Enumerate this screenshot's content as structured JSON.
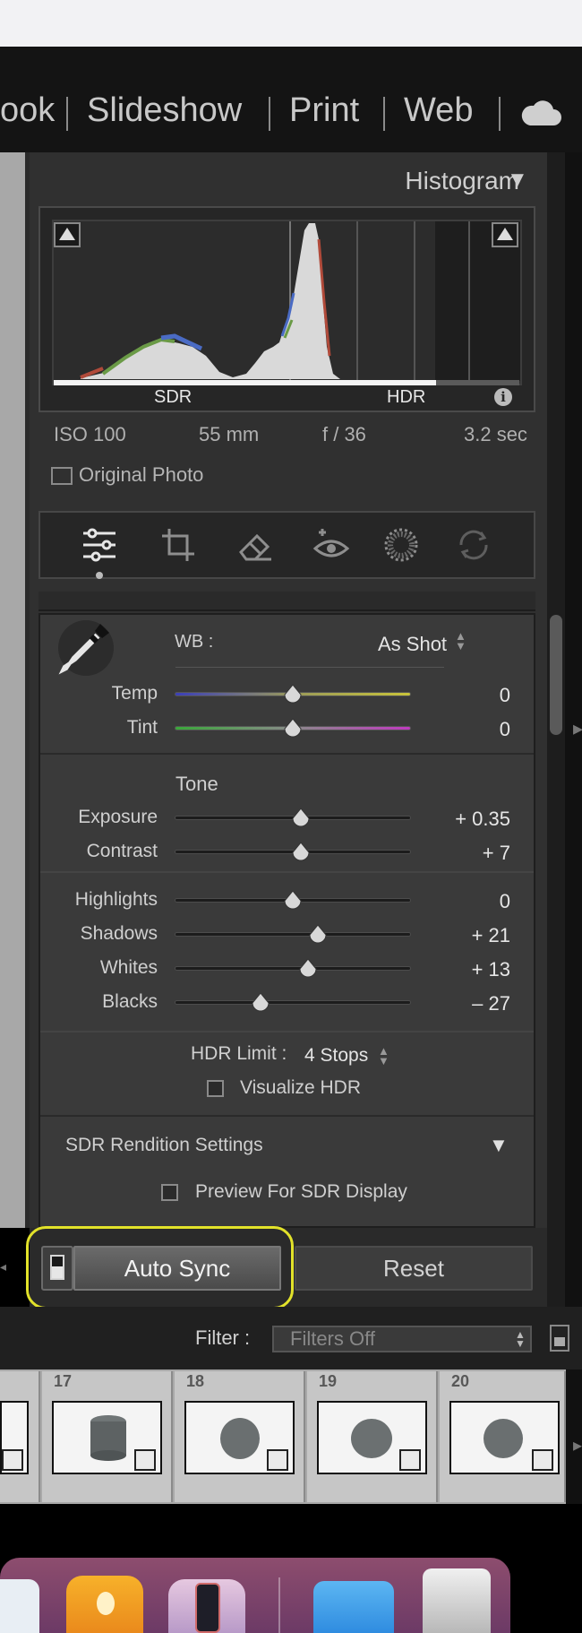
{
  "nav": {
    "modules": [
      "ook",
      "Slideshow",
      "Print",
      "Web"
    ],
    "cloud_icon": "cloud-icon"
  },
  "histogram": {
    "title": "Histogram",
    "sdr_label": "SDR",
    "hdr_label": "HDR",
    "exif": {
      "iso": "ISO 100",
      "focal": "55 mm",
      "aperture": "f / 36",
      "shutter": "3.2 sec"
    },
    "original_photo_label": "Original Photo"
  },
  "tools": [
    "edit-sliders-icon",
    "crop-icon",
    "eraser-icon",
    "redeye-icon",
    "masking-icon",
    "presets-icon"
  ],
  "white_balance": {
    "label": "WB :",
    "value": "As Shot",
    "sliders": [
      {
        "name": "Temp",
        "value": "0",
        "position": 0.5
      },
      {
        "name": "Tint",
        "value": "0",
        "position": 0.5
      }
    ]
  },
  "tone": {
    "label": "Tone",
    "sliders": [
      {
        "name": "Exposure",
        "value": "+ 0.35",
        "position": 0.535
      },
      {
        "name": "Contrast",
        "value": "+ 7",
        "position": 0.535
      },
      {
        "name": "Highlights",
        "value": "0",
        "position": 0.5
      },
      {
        "name": "Shadows",
        "value": "+ 21",
        "position": 0.605
      },
      {
        "name": "Whites",
        "value": "+ 13",
        "position": 0.565
      },
      {
        "name": "Blacks",
        "value": "– 27",
        "position": 0.365
      }
    ]
  },
  "hdr": {
    "limit_label": "HDR Limit :",
    "limit_value": "4 Stops",
    "visualize_label": "Visualize HDR"
  },
  "sdr_rendition": {
    "title": "SDR Rendition Settings",
    "preview_label": "Preview For SDR Display"
  },
  "buttons": {
    "auto_sync": "Auto Sync",
    "reset": "Reset"
  },
  "filter": {
    "label": "Filter :",
    "value": "Filters Off"
  },
  "filmstrip": {
    "numbers": [
      "17",
      "18",
      "19",
      "20"
    ]
  },
  "colors": {
    "highlight": "#e2e22a",
    "panel_bg": "#3a3a3a"
  }
}
